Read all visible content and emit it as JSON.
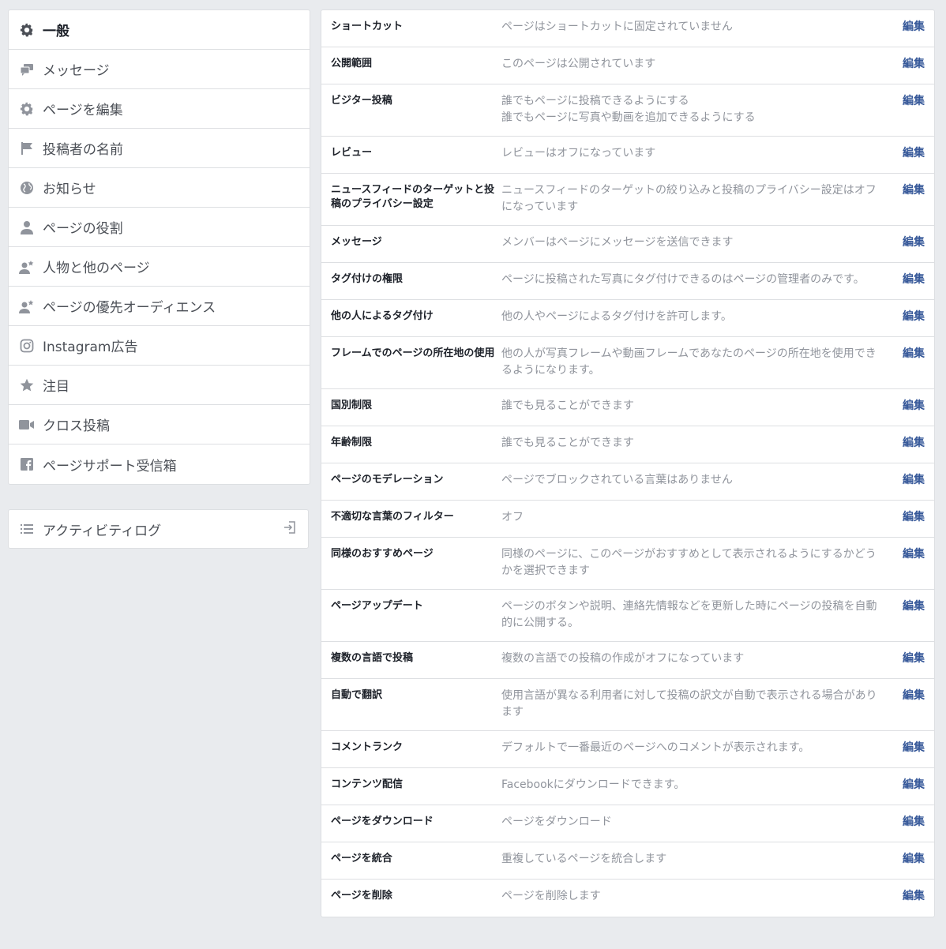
{
  "sidebar": {
    "items": [
      {
        "label": "一般",
        "icon": "gear-icon"
      },
      {
        "label": "メッセージ",
        "icon": "chat-bubbles-icon"
      },
      {
        "label": "ページを編集",
        "icon": "gear-icon"
      },
      {
        "label": "投稿者の名前",
        "icon": "flag-icon"
      },
      {
        "label": "お知らせ",
        "icon": "globe-icon"
      },
      {
        "label": "ページの役割",
        "icon": "person-icon"
      },
      {
        "label": "人物と他のページ",
        "icon": "person-star-icon"
      },
      {
        "label": "ページの優先オーディエンス",
        "icon": "person-star-icon"
      },
      {
        "label": "Instagram広告",
        "icon": "instagram-icon"
      },
      {
        "label": "注目",
        "icon": "star-icon"
      },
      {
        "label": "クロス投稿",
        "icon": "video-camera-icon"
      },
      {
        "label": "ページサポート受信箱",
        "icon": "facebook-icon"
      }
    ],
    "activity_log": {
      "label": "アクティビティログ",
      "icon": "list-icon",
      "action_icon": "sign-in-icon"
    }
  },
  "settings": {
    "edit_label": "編集",
    "rows": [
      {
        "label": "ショートカット",
        "value": [
          "ページはショートカットに固定されていません"
        ]
      },
      {
        "label": "公開範囲",
        "value": [
          "このページは公開されています"
        ]
      },
      {
        "label": "ビジター投稿",
        "value": [
          "誰でもページに投稿できるようにする",
          "誰でもページに写真や動画を追加できるようにする"
        ]
      },
      {
        "label": "レビュー",
        "value": [
          "レビューはオフになっています"
        ]
      },
      {
        "label": "ニュースフィードのターゲットと投稿のプライバシー設定",
        "value": [
          "ニュースフィードのターゲットの絞り込みと投稿のプライバシー設定はオフになっています"
        ]
      },
      {
        "label": "メッセージ",
        "value": [
          "メンバーはページにメッセージを送信できます"
        ]
      },
      {
        "label": "タグ付けの権限",
        "value": [
          "ページに投稿された写真にタグ付けできるのはページの管理者のみです。"
        ]
      },
      {
        "label": "他の人によるタグ付け",
        "value": [
          "他の人やページによるタグ付けを許可します。"
        ]
      },
      {
        "label": "フレームでのページの所在地の使用",
        "value": [
          "他の人が写真フレームや動画フレームであなたのページの所在地を使用できるようになります。"
        ]
      },
      {
        "label": "国別制限",
        "value": [
          "誰でも見ることができます"
        ]
      },
      {
        "label": "年齢制限",
        "value": [
          "誰でも見ることができます"
        ]
      },
      {
        "label": "ページのモデレーション",
        "value": [
          "ページでブロックされている言葉はありません"
        ]
      },
      {
        "label": "不適切な言葉のフィルター",
        "value": [
          "オフ"
        ]
      },
      {
        "label": "同様のおすすめページ",
        "value": [
          "同様のページに、このページがおすすめとして表示されるようにするかどうかを選択できます"
        ]
      },
      {
        "label": "ページアップデート",
        "value": [
          "ページのボタンや説明、連絡先情報などを更新した時にページの投稿を自動的に公開する。"
        ]
      },
      {
        "label": "複数の言語で投稿",
        "value": [
          "複数の言語での投稿の作成がオフになっています"
        ]
      },
      {
        "label": "自動で翻訳",
        "value": [
          "使用言語が異なる利用者に対して投稿の訳文が自動で表示される場合があります"
        ]
      },
      {
        "label": "コメントランク",
        "value": [
          "デフォルトで一番最近のページへのコメントが表示されます。"
        ]
      },
      {
        "label": "コンテンツ配信",
        "value": [
          "Facebookにダウンロードできます。"
        ]
      },
      {
        "label": "ページをダウンロード",
        "value": [
          "ページをダウンロード"
        ]
      },
      {
        "label": "ページを統合",
        "value": [
          "重複しているページを統合します"
        ]
      },
      {
        "label": "ページを削除",
        "value": [
          "ページを削除します"
        ]
      }
    ]
  }
}
